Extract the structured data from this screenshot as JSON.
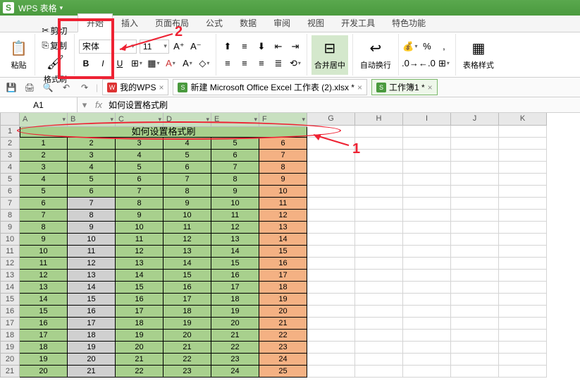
{
  "app": {
    "title": "WPS 表格"
  },
  "tabs": [
    "开始",
    "插入",
    "页面布局",
    "公式",
    "数据",
    "审阅",
    "视图",
    "开发工具",
    "特色功能"
  ],
  "active_tab": 0,
  "ribbon": {
    "paste": "粘贴",
    "cut": "剪切",
    "copy": "复制",
    "format_painter": "格式刷",
    "font_family": "宋体",
    "font_size": "11",
    "merge_center": "合并居中",
    "wrap_text": "自动换行",
    "table_style": "表格样式"
  },
  "docs": [
    {
      "icon": "W",
      "label": "我的WPS",
      "active": false
    },
    {
      "icon": "S",
      "label": "新建 Microsoft Office Excel 工作表 (2).xlsx *",
      "active": false
    },
    {
      "icon": "S",
      "label": "工作簿1 *",
      "active": true
    }
  ],
  "namebox": {
    "ref": "A1",
    "formula": "如何设置格式刷"
  },
  "columns": [
    "A",
    "B",
    "C",
    "D",
    "E",
    "F",
    "G",
    "H",
    "I",
    "J",
    "K"
  ],
  "title_cell": "如何设置格式刷",
  "annotations": {
    "a1": "1",
    "a2": "2"
  },
  "chart_data": {
    "type": "table",
    "title": "如何设置格式刷",
    "columns": [
      "A",
      "B",
      "C",
      "D",
      "E",
      "F"
    ],
    "rows": [
      [
        1,
        2,
        3,
        4,
        5,
        6
      ],
      [
        2,
        3,
        4,
        5,
        6,
        7
      ],
      [
        3,
        4,
        5,
        6,
        7,
        8
      ],
      [
        4,
        5,
        6,
        7,
        8,
        9
      ],
      [
        5,
        6,
        7,
        8,
        9,
        10
      ],
      [
        6,
        7,
        8,
        9,
        10,
        11
      ],
      [
        7,
        8,
        9,
        10,
        11,
        12
      ],
      [
        8,
        9,
        10,
        11,
        12,
        13
      ],
      [
        9,
        10,
        11,
        12,
        13,
        14
      ],
      [
        10,
        11,
        12,
        13,
        14,
        15
      ],
      [
        11,
        12,
        13,
        14,
        15,
        16
      ],
      [
        12,
        13,
        14,
        15,
        16,
        17
      ],
      [
        13,
        14,
        15,
        16,
        17,
        18
      ],
      [
        14,
        15,
        16,
        17,
        18,
        19
      ],
      [
        15,
        16,
        17,
        18,
        19,
        20
      ],
      [
        16,
        17,
        18,
        19,
        20,
        21
      ],
      [
        17,
        18,
        19,
        20,
        21,
        22
      ],
      [
        18,
        19,
        20,
        21,
        22,
        23
      ],
      [
        19,
        20,
        21,
        22,
        23,
        24
      ],
      [
        20,
        21,
        22,
        23,
        24,
        25
      ]
    ],
    "col_B_gray_rows_from": 7
  }
}
